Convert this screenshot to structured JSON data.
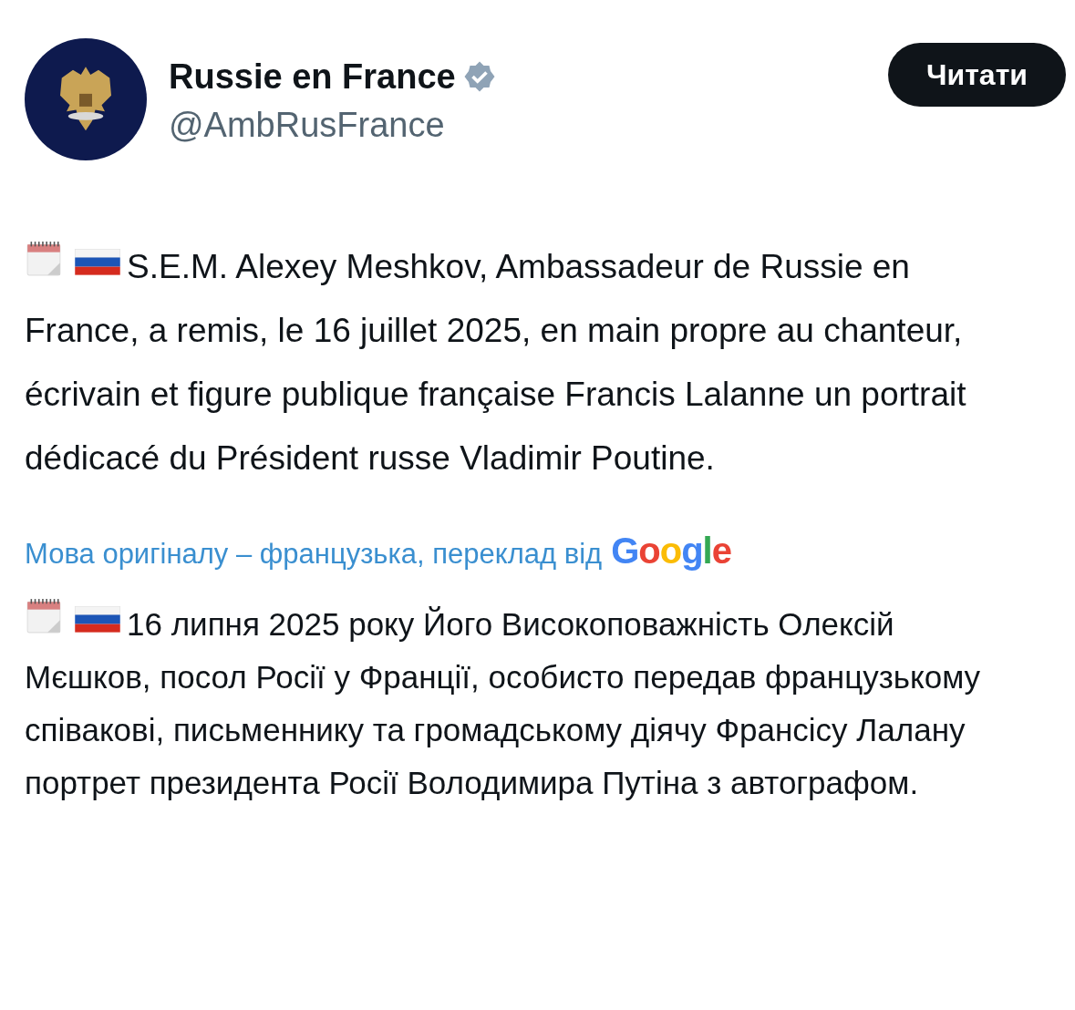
{
  "account": {
    "name": "Russie en France",
    "handle": "@AmbRusFrance",
    "verified": true
  },
  "follow_button": {
    "label": "Читати"
  },
  "post": {
    "text": "S.E.M. Alexey Meshkov, Ambassadeur de Russie en France, a remis, le 16 juillet 2025, en main propre au chanteur, écrivain et figure publique française Francis Lalanne un portrait dédicacé du Président russe Vladimir Poutine."
  },
  "translation": {
    "note": "Мова оригіналу – французька, переклад від",
    "provider": "Google",
    "text": "16 липня 2025 року Його Високоповажність Олексій Мєшков, посол Росії у Франції, особисто передав французькому співакові, письменнику та громадському діячу Франсісу Лалану портрет президента Росії Володимира Путіна з автографом."
  }
}
